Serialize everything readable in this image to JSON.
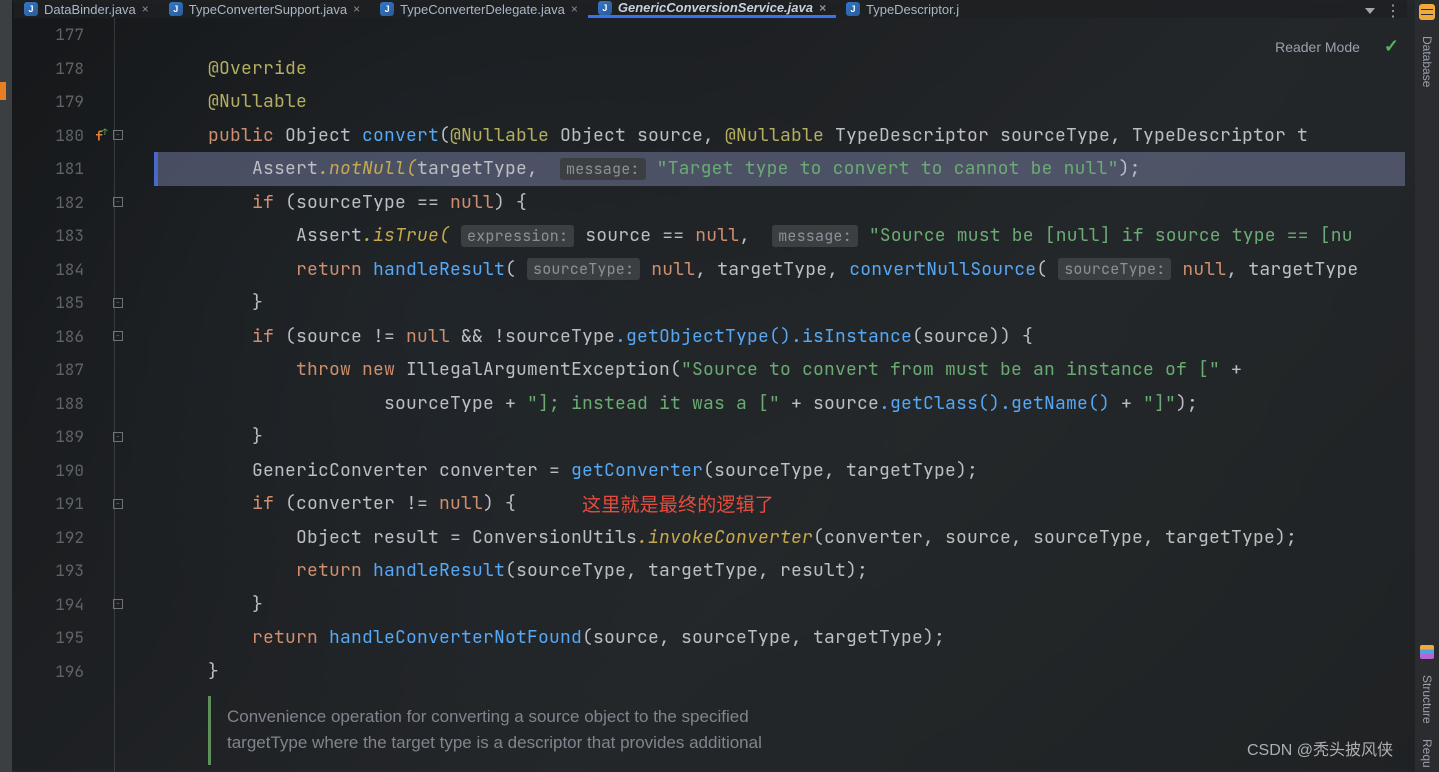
{
  "tabs": [
    {
      "label": "DataBinder.java"
    },
    {
      "label": "TypeConverterSupport.java"
    },
    {
      "label": "TypeConverterDelegate.java"
    },
    {
      "label": "GenericConversionService.java"
    },
    {
      "label": "TypeDescriptor.j"
    }
  ],
  "activeTab": 3,
  "readerMode": "Reader Mode",
  "rightbar": {
    "database": "Database",
    "structure": "Structure",
    "requ": "Requ"
  },
  "lines": {
    "177": "177",
    "178": "178",
    "179": "179",
    "180": "180",
    "181": "181",
    "182": "182",
    "183": "183",
    "184": "184",
    "185": "185",
    "186": "186",
    "187": "187",
    "188": "188",
    "189": "189",
    "190": "190",
    "191": "191",
    "192": "192",
    "193": "193",
    "194": "194",
    "195": "195",
    "196": "196"
  },
  "code": {
    "override": "@Override",
    "nullable": "@Nullable",
    "l180": {
      "public": "public",
      "object": "Object",
      "convert": "convert",
      "open": "(",
      "ann": "@Nullable",
      "obj2": "Object",
      "src": "source",
      "comma": ", ",
      "ann2": "@Nullable",
      "td": "TypeDescriptor",
      "stype": "sourceType",
      "comma2": ", ",
      "td2": "TypeDescriptor",
      "ttail": "t"
    },
    "l181": {
      "assert": "Assert",
      "notnull": ".notNull(",
      "tgt": "targetType",
      "c": ", ",
      "p": "message:",
      "s": "\"Target type to convert to cannot be null\"",
      "end": ");"
    },
    "l182": {
      "if": "if",
      "open": " (",
      "st": "sourceType",
      "eq": " == ",
      "null": "null",
      "close": ") {"
    },
    "l183": {
      "assert": "Assert",
      "ist": ".isTrue( ",
      "p1": "expression:",
      "sp": " ",
      "src": "source",
      "eq": " == ",
      "null": "null",
      "c": ",  ",
      "p2": "message:",
      "sp2": " ",
      "s": "\"Source must be [null] if source type == [nu"
    },
    "l184": {
      "ret": "return",
      "sp": " ",
      "hr": "handleResult",
      "open": "( ",
      "p": "sourceType:",
      "sp2": " ",
      "null": "null",
      "c": ", ",
      "tt": "targetType",
      "c2": ", ",
      "cns": "convertNullSource",
      "open2": "( ",
      "p2": "sourceType:",
      "sp3": " ",
      "null2": "null",
      "c3": ", ",
      "tt2": "targetType"
    },
    "l186": {
      "if": "if",
      "open": " (",
      "src": "source",
      "neq": " != ",
      "null": "null",
      "amp": " && !",
      "st": "sourceType",
      "got": ".getObjectType()",
      "isi": ".isInstance",
      "open2": "(",
      "src2": "source",
      "close": ")) {"
    },
    "l187": {
      "throw": "throw",
      "sp": " ",
      "new": "new",
      "sp2": " ",
      "iae": "IllegalArgumentException",
      "open": "(",
      "s": "\"Source to convert from must be an instance of [\"",
      "plus": " +"
    },
    "l188": {
      "st": "sourceType",
      "plus": " + ",
      "s1": "\"]; instead it was a [\"",
      "plus2": " + ",
      "src": "source",
      "gc": ".getClass()",
      "gn": ".getName()",
      "plus3": " + ",
      "s2": "\"]\"",
      "end": ");"
    },
    "l190": {
      "gc": "GenericConverter",
      "sp": " ",
      "conv": "converter",
      "eq": " = ",
      "getc": "getConverter",
      "open": "(",
      "st": "sourceType",
      "c": ", ",
      "tt": "targetType",
      "end": ");"
    },
    "l191": {
      "if": "if",
      "open": " (",
      "conv": "converter",
      "neq": " != ",
      "null": "null",
      "close": ") {",
      "red": "这里就是最终的逻辑了"
    },
    "l192": {
      "obj": "Object",
      "sp": " ",
      "res": "result",
      "eq": " = ",
      "cu": "ConversionUtils",
      "ic": ".invokeConverter",
      "open": "(",
      "conv": "converter",
      "c": ", ",
      "src": "source",
      "c2": ", ",
      "st": "sourceType",
      "c3": ", ",
      "tt": "targetType",
      "end": ");"
    },
    "l193": {
      "ret": "return",
      "sp": " ",
      "hr": "handleResult",
      "open": "(",
      "st": "sourceType",
      "c": ", ",
      "tt": "targetType",
      "c2": ", ",
      "res": "result",
      "end": ");"
    },
    "l195": {
      "ret": "return",
      "sp": " ",
      "hcnf": "handleConverterNotFound",
      "open": "(",
      "src": "source",
      "c": ", ",
      "st": "sourceType",
      "c2": ", ",
      "tt": "targetType",
      "end": ");"
    },
    "brace": "}"
  },
  "doc": {
    "l1": "Convenience operation for converting a source object to the specified",
    "l2": "targetType  where the target type is a descriptor that provides additional"
  },
  "watermark": "CSDN @秃头披风侠"
}
